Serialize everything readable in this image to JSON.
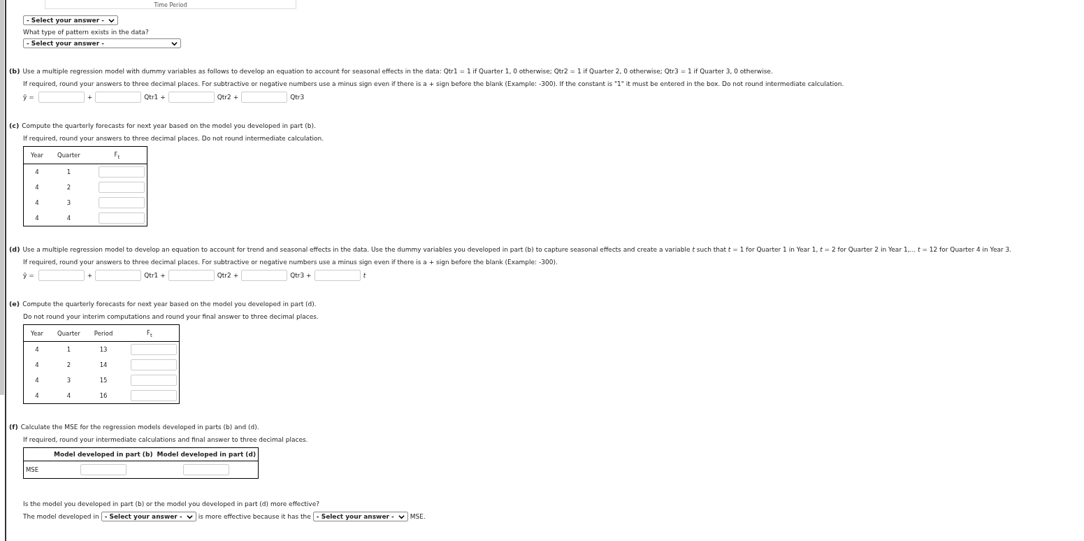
{
  "chart_fragment": {
    "axis_title": "Time Period"
  },
  "part_a": {
    "select_1": {
      "value": "- Select your answer -"
    },
    "question": "What type of pattern exists in the data?",
    "select_2": {
      "value": "- Select your answer -"
    }
  },
  "parts": [
    {
      "kind": "equation",
      "letter": "(b)",
      "prompt": "Use a multiple regression model with dummy variables as follows to develop an equation to account for seasonal effects in the data: Qtr1 = 1 if Quarter 1, 0 otherwise; Qtr2 = 1 if Quarter 2, 0 otherwise; Qtr3 = 1 if Quarter 3, 0 otherwise.",
      "instruction": "If required, round your answers to three decimal places. For subtractive or negative numbers use a minus sign even if there is a + sign before the blank (Example: -300). If the constant is \"1\" it must be entered in the box. Do not round intermediate calculation.",
      "lhs": "ŷ =",
      "terms": [
        {
          "suffix": "+"
        },
        {
          "suffix": "Qtr1 +"
        },
        {
          "suffix": "Qtr2 +"
        },
        {
          "suffix": "Qtr3"
        }
      ]
    },
    {
      "kind": "table",
      "letter": "(c)",
      "prompt": "Compute the quarterly forecasts for next year based on the model you developed in part (b).",
      "instruction": "If required, round your answers to three decimal places. Do not round intermediate calculation.",
      "columns": [
        {
          "label": "Year",
          "kind": "text"
        },
        {
          "label": "Quarter",
          "kind": "text"
        },
        {
          "label": "F$_{t}$",
          "kind": "input"
        }
      ],
      "rows": [
        {
          "cells": [
            "4",
            "1"
          ]
        },
        {
          "cells": [
            "4",
            "2"
          ]
        },
        {
          "cells": [
            "4",
            "3"
          ]
        },
        {
          "cells": [
            "4",
            "4"
          ]
        }
      ]
    },
    {
      "kind": "equation",
      "letter": "(d)",
      "prompt": "Use a multiple regression model to develop an equation to account for trend and seasonal effects in the data. Use the dummy variables you developed in part (b) to capture seasonal effects and create a variable *t* such that *t* = 1 for Quarter 1 in Year 1, *t* = 2 for Quarter 2 in Year 1,... *t* = 12 for Quarter 4 in Year 3.",
      "instruction": "If required, round your answers to three decimal places. For subtractive or negative numbers use a minus sign even if there is a + sign before the blank (Example: -300).",
      "lhs": "ŷ =",
      "terms": [
        {
          "suffix": "+"
        },
        {
          "suffix": "Qtr1 +"
        },
        {
          "suffix": "Qtr2 +"
        },
        {
          "suffix": "Qtr3 +"
        },
        {
          "suffix": "*t*"
        }
      ]
    },
    {
      "kind": "table",
      "letter": "(e)",
      "prompt": "Compute the quarterly forecasts for next year based on the model you developed in part (d).",
      "instruction": "Do not round your interim computations and round your final answer to three decimal places.",
      "columns": [
        {
          "label": "Year",
          "kind": "text"
        },
        {
          "label": "Quarter",
          "kind": "text"
        },
        {
          "label": "Period",
          "kind": "text"
        },
        {
          "label": "F$_{t}$",
          "kind": "input"
        }
      ],
      "rows": [
        {
          "cells": [
            "4",
            "1",
            "13"
          ]
        },
        {
          "cells": [
            "4",
            "2",
            "14"
          ]
        },
        {
          "cells": [
            "4",
            "3",
            "15"
          ]
        },
        {
          "cells": [
            "4",
            "4",
            "16"
          ]
        }
      ]
    },
    {
      "kind": "mse",
      "letter": "(f)",
      "prompt": "Calculate the MSE for the regression models developed in parts (b) and (d).",
      "instruction": "If required, round your intermediate calculations and final answer to three decimal places.",
      "columns": [
        {
          "label": "Model developed in part (b)"
        },
        {
          "label": "Model developed in part (d)"
        }
      ],
      "rows": [
        {
          "label": "MSE"
        }
      ]
    }
  ],
  "conclusion": {
    "question": "Is the model you developed in part (b) or the model you developed in part (d) more effective?",
    "sentence": [
      {
        "kind": "text",
        "text": "The model developed in"
      },
      {
        "kind": "select",
        "value": "- Select your answer -"
      },
      {
        "kind": "text",
        "text": "is more effective because it has the"
      },
      {
        "kind": "select",
        "value": "- Select your answer -"
      },
      {
        "kind": "text",
        "text": "MSE."
      }
    ]
  }
}
